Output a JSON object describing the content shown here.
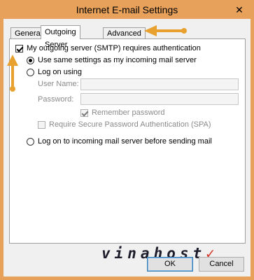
{
  "window": {
    "title": "Internet E-mail Settings",
    "close_glyph": "✕"
  },
  "tabs": [
    {
      "label": "General",
      "active": false
    },
    {
      "label": "Outgoing Server",
      "active": true
    },
    {
      "label": "Advanced",
      "active": false
    }
  ],
  "outgoing": {
    "requires_auth_label": "My outgoing server (SMTP) requires authentication",
    "requires_auth_checked": true,
    "use_same_settings_label": "Use same settings as my incoming mail server",
    "log_on_using_label": "Log on using",
    "user_name_label": "User Name:",
    "user_name_value": "",
    "password_label": "Password:",
    "password_value": "",
    "remember_password_label": "Remember password",
    "remember_password_checked": true,
    "spa_label": "Require Secure Password Authentication (SPA)",
    "spa_checked": false,
    "log_on_incoming_label": "Log on to incoming mail server before sending mail"
  },
  "buttons": {
    "ok": "OK",
    "cancel": "Cancel"
  },
  "watermark": {
    "text": "vinahost",
    "mark": "✓"
  },
  "colors": {
    "frame": "#e7a15a",
    "annotation_arrow": "#e8a12e",
    "default_button_border": "#3c7fb1"
  }
}
